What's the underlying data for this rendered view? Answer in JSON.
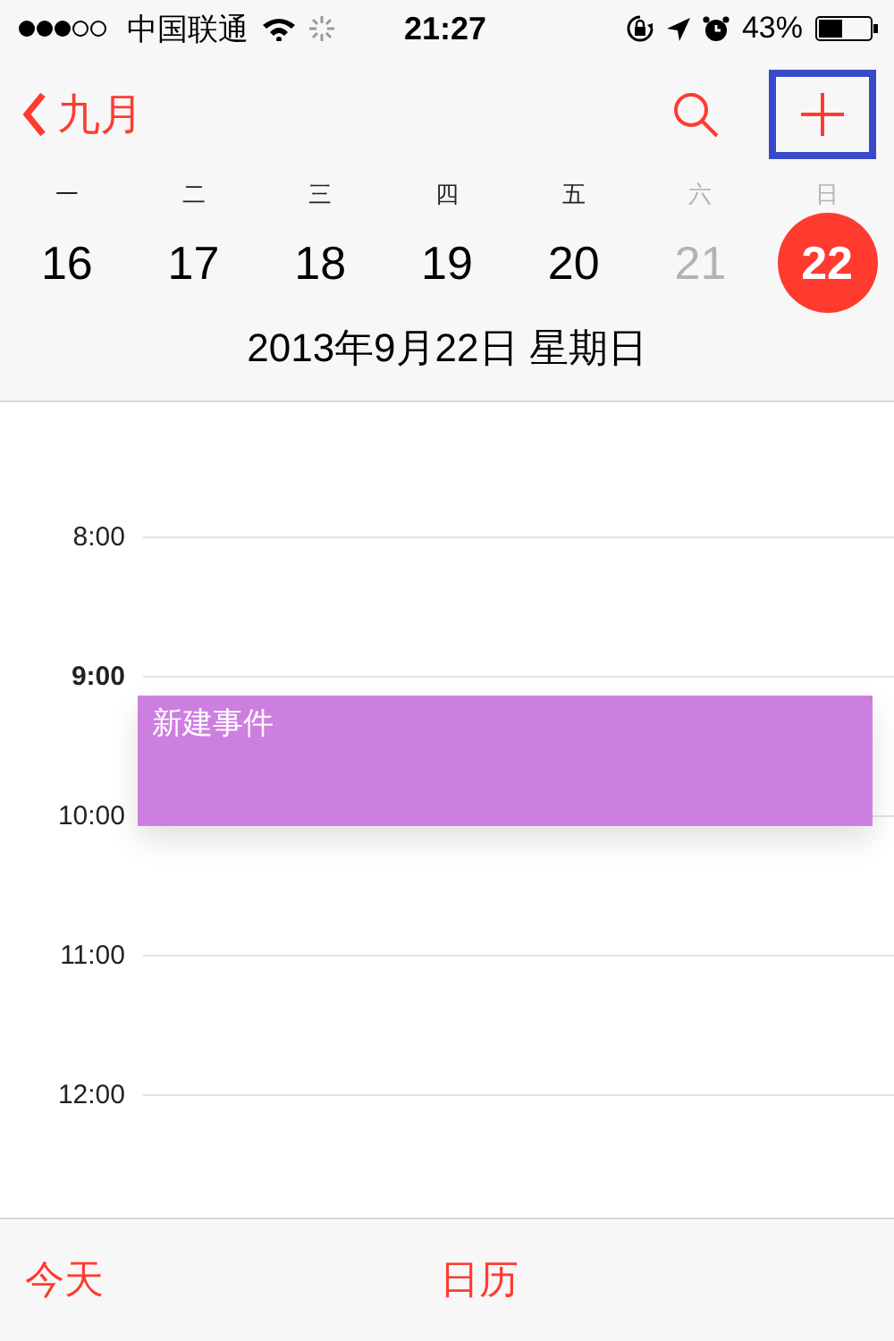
{
  "status_bar": {
    "carrier": "中国联通",
    "time": "21:27",
    "battery": "43%"
  },
  "nav": {
    "back_label": "九月",
    "add_button": {
      "highlighted": true
    }
  },
  "week": [
    {
      "weekday": "一",
      "date": "16",
      "muted": false,
      "selected": false
    },
    {
      "weekday": "二",
      "date": "17",
      "muted": false,
      "selected": false
    },
    {
      "weekday": "三",
      "date": "18",
      "muted": false,
      "selected": false
    },
    {
      "weekday": "四",
      "date": "19",
      "muted": false,
      "selected": false
    },
    {
      "weekday": "五",
      "date": "20",
      "muted": false,
      "selected": false
    },
    {
      "weekday": "六",
      "date": "21",
      "muted": true,
      "selected": false
    },
    {
      "weekday": "日",
      "date": "22",
      "muted": true,
      "selected": true
    }
  ],
  "selected_date": "2013年9月22日 星期日",
  "hours": [
    {
      "label": "8:00",
      "emphasized": false
    },
    {
      "label": "9:00",
      "emphasized": true
    },
    {
      "label": "10:00",
      "emphasized": false
    },
    {
      "label": "11:00",
      "emphasized": false
    },
    {
      "label": "12:00",
      "emphasized": false
    }
  ],
  "event": {
    "title": "新建事件",
    "color": "#cd7fe0"
  },
  "tab_bar": [
    {
      "label": "今天"
    },
    {
      "label": "日历"
    }
  ]
}
